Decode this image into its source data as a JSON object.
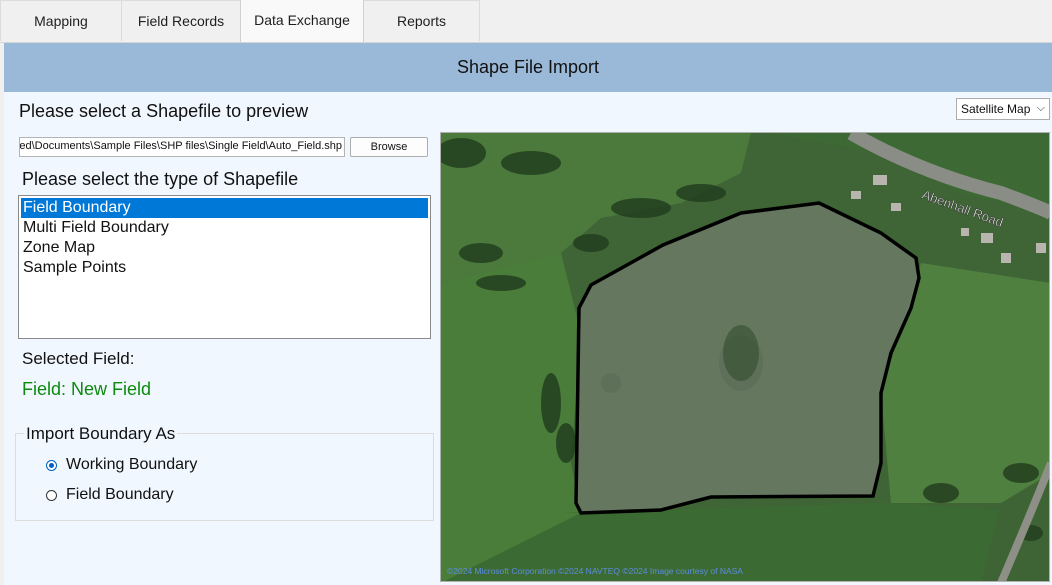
{
  "tabs": [
    {
      "label": "Mapping",
      "active": false
    },
    {
      "label": "Field Records",
      "active": false
    },
    {
      "label": "Data Exchange",
      "active": true
    },
    {
      "label": "Reports",
      "active": false
    }
  ],
  "panel": {
    "title": "Shape File Import",
    "select_prompt": "Please select a Shapefile to preview",
    "file_path": "C:\\Users\\...ed\\Documents\\Sample Files\\SHP files\\Single Field\\Auto_Field.shp",
    "file_path_visible": "ed\\Documents\\Sample Files\\SHP files\\Single Field\\Auto_Field.shp",
    "browse_label": "Browse",
    "type_prompt": "Please select the type of Shapefile",
    "types": [
      "Field Boundary",
      "Multi Field Boundary",
      "Zone Map",
      "Sample Points"
    ],
    "selected_type": "Field Boundary",
    "selected_field_label": "Selected Field:",
    "selected_field_value": "Field: New Field",
    "selected_field_color": "#0d8a0d",
    "import_group_label": "Import Boundary As",
    "import_options": [
      {
        "label": "Working Boundary",
        "checked": true
      },
      {
        "label": "Field Boundary",
        "checked": false
      }
    ]
  },
  "map": {
    "view_select_value": "Satellite Map",
    "road_label": "Abenhall Road",
    "copyright": "©2024 Microsoft Corporation  ©2024 NAVTEQ  ©2024 Image courtesy of NASA",
    "boundary_color": "#000000"
  },
  "colors": {
    "title_bar": "#9ab9d8",
    "panel_bg": "#f1f7fe",
    "selection": "#0078d7"
  }
}
